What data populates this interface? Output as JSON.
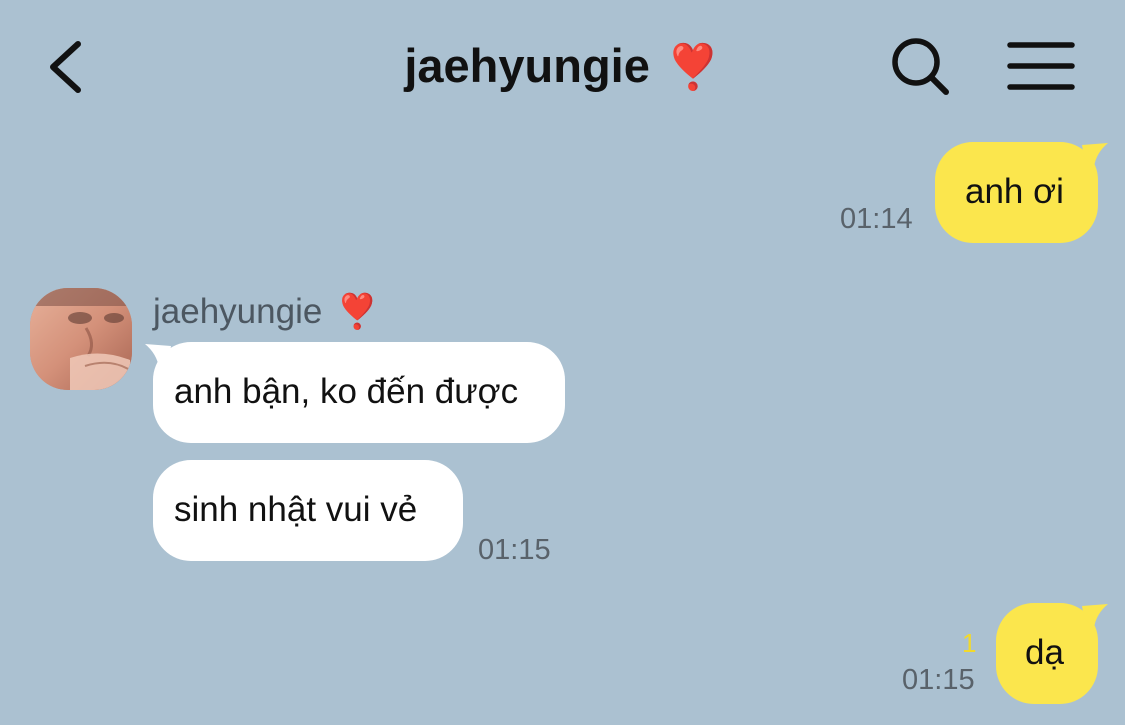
{
  "header": {
    "title": "jaehyungie",
    "title_emoji": "❣️",
    "back_icon": "chevron-left-icon",
    "search_icon": "search-icon",
    "menu_icon": "hamburger-menu-icon"
  },
  "colors": {
    "background": "#abc1d1",
    "my_bubble": "#fbe64d",
    "their_bubble": "#ffffff",
    "unread_count": "#f2d92b"
  },
  "messages": [
    {
      "sender": "me",
      "text": "anh ơi",
      "time": "01:14"
    },
    {
      "sender": "jaehyungie",
      "sender_emoji": "❣️",
      "text": "anh bận, ko đến được"
    },
    {
      "sender": "jaehyungie",
      "text": "sinh nhật vui vẻ",
      "time": "01:15"
    },
    {
      "sender": "me",
      "text": "dạ",
      "time": "01:15",
      "unread": "1"
    }
  ]
}
